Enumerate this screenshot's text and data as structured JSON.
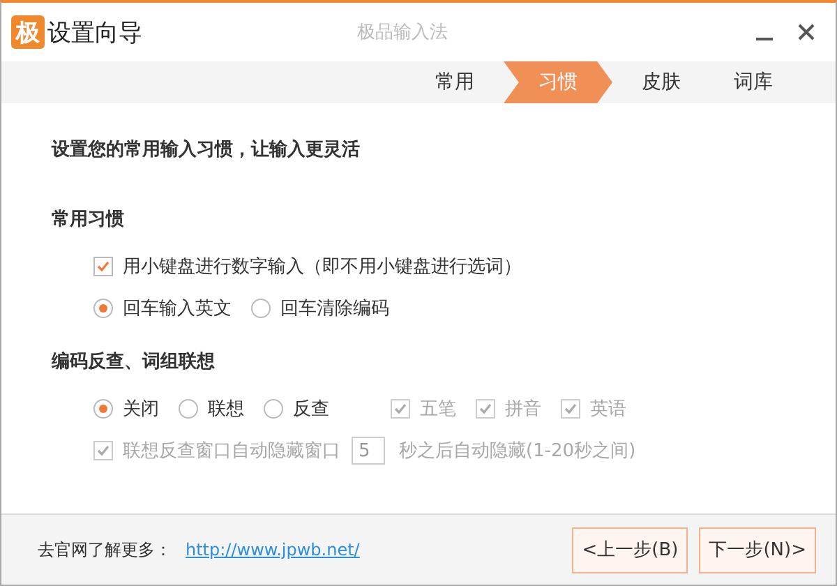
{
  "window": {
    "logo": "极",
    "title": "设置向导",
    "app_name": "极品输入法"
  },
  "steps": [
    {
      "label": "常用",
      "selected": false
    },
    {
      "label": "习惯",
      "selected": true
    },
    {
      "label": "皮肤",
      "selected": false
    },
    {
      "label": "词库",
      "selected": false
    }
  ],
  "intro": "设置您的常用输入习惯，让输入更灵活",
  "sections": [
    {
      "title": "常用习惯",
      "lines": [
        {
          "options": [
            {
              "kind": "checkbox",
              "label": "用小键盘进行数字输入（即不用小键盘进行选词）",
              "checked": true,
              "disabled": false
            }
          ]
        },
        {
          "options": [
            {
              "kind": "radio",
              "label": "回车输入英文",
              "selected": true,
              "disabled": false
            },
            {
              "kind": "radio",
              "label": "回车清除编码",
              "selected": false,
              "disabled": false
            }
          ]
        }
      ]
    },
    {
      "title": "编码反查、词组联想",
      "lines": [
        {
          "options": [
            {
              "kind": "radio",
              "label": "关闭",
              "selected": true,
              "disabled": false
            },
            {
              "kind": "radio",
              "label": "联想",
              "selected": false,
              "disabled": false
            },
            {
              "kind": "radio",
              "label": "反查",
              "selected": false,
              "disabled": false
            },
            {
              "kind": "checkbox",
              "label": "五笔",
              "checked": true,
              "disabled": true
            },
            {
              "kind": "checkbox",
              "label": "拼音",
              "checked": true,
              "disabled": true
            },
            {
              "kind": "checkbox",
              "label": "英语",
              "checked": true,
              "disabled": true
            }
          ]
        },
        {
          "options": [
            {
              "kind": "checkbox",
              "label": "联想反查窗口自动隐藏窗口",
              "checked": true,
              "disabled": true
            },
            {
              "kind": "field",
              "value": "5",
              "disabled": true
            },
            {
              "kind": "text",
              "text": "秒之后自动隐藏(1-20秒之间)",
              "disabled": true
            }
          ]
        }
      ]
    }
  ],
  "footer": {
    "text": "去官网了解更多：",
    "link": "http://www.jpwb.net/",
    "buttons": [
      "<上一步(B)",
      "下一步(N)>"
    ]
  }
}
